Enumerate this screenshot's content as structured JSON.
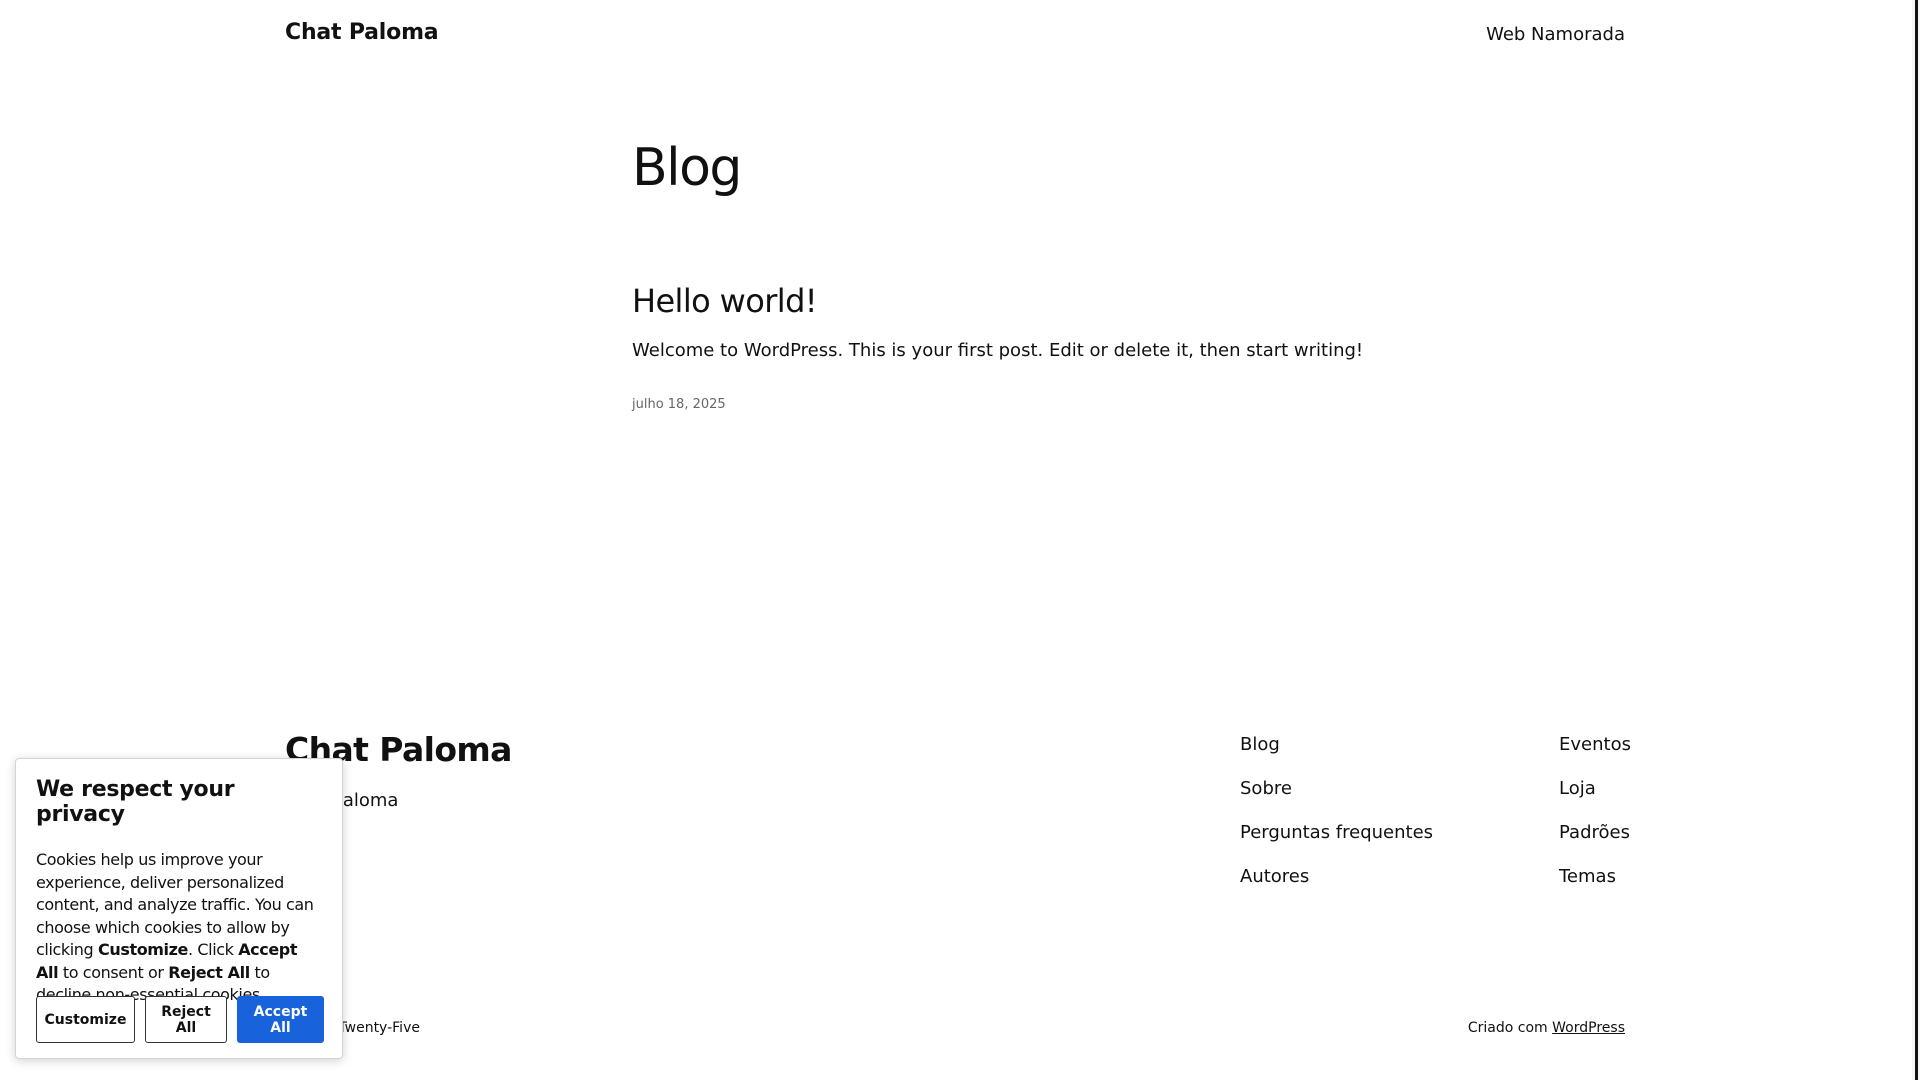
{
  "header": {
    "site_title": "Chat Paloma",
    "nav_link": "Web Namorada"
  },
  "main": {
    "heading": "Blog",
    "posts": [
      {
        "title": "Hello world!",
        "excerpt": "Welcome to WordPress. This is your first post. Edit or delete it, then start writing!",
        "date": "julho 18, 2025"
      }
    ]
  },
  "footer": {
    "title": "Chat Paloma",
    "tagline": "Chat Paloma",
    "nav_col1": [
      "Blog",
      "Sobre",
      "Perguntas frequentes",
      "Autores"
    ],
    "nav_col2": [
      "Eventos",
      "Loja",
      "Padrões",
      "Temas"
    ],
    "credit_left": "Twenty Twenty-Five",
    "credit_right_prefix": "Criado com",
    "credit_right_link": "WordPress"
  },
  "cookie_banner": {
    "title": "We respect your privacy",
    "text_part1": "Cookies help us improve your experience, deliver personalized content, and analyze traffic. You can choose which cookies to allow by clicking ",
    "text_customize": "Customize",
    "text_part2": ". Click ",
    "text_accept": "Accept All",
    "text_part3": " to consent or ",
    "text_reject": "Reject All",
    "text_part4": " to decline non-essential cookies.",
    "buttons": {
      "customize": "Customize",
      "reject": "Reject All",
      "accept": "Accept All"
    },
    "accent_color": "#1863dc"
  }
}
